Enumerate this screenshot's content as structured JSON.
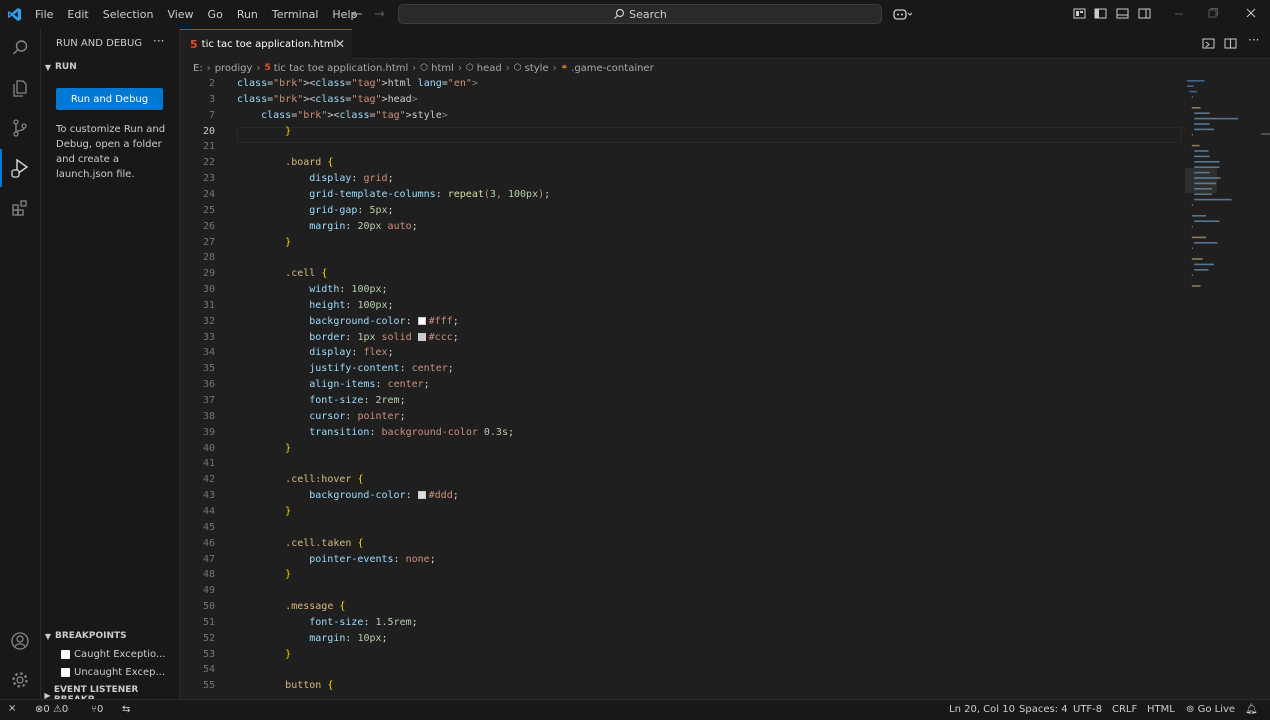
{
  "menu": [
    "File",
    "Edit",
    "Selection",
    "View",
    "Go",
    "Run",
    "Terminal",
    "Help"
  ],
  "search": {
    "label": "Search"
  },
  "sidebar": {
    "title": "RUN AND DEBUG",
    "run_section": "RUN",
    "run_button": "Run and Debug",
    "help_text": "To customize Run and Debug, open a folder and create a launch.json file.",
    "breakpoints_section": "BREAKPOINTS",
    "breakpoints": [
      "Caught Exceptio...",
      "Uncaught Excep..."
    ],
    "event_listener_section": "EVENT LISTENER BREAKP..."
  },
  "tab": {
    "label": "tic tac toe application.html"
  },
  "breadcrumb": {
    "drive": "E:",
    "items": [
      "prodigy",
      "tic tac toe application.html",
      "html",
      "head",
      "style",
      ".game-container"
    ]
  },
  "code": {
    "lines": [
      {
        "n": "2",
        "t": "<html lang=\"en\">"
      },
      {
        "n": "3",
        "t": "<head>"
      },
      {
        "n": "7",
        "t": "    <style>"
      },
      {
        "n": "20",
        "t": "        }"
      },
      {
        "n": "21",
        "t": ""
      },
      {
        "n": "22",
        "t": "        .board {"
      },
      {
        "n": "23",
        "t": "            display: grid;"
      },
      {
        "n": "24",
        "t": "            grid-template-columns: repeat(3, 100px);"
      },
      {
        "n": "25",
        "t": "            grid-gap: 5px;"
      },
      {
        "n": "26",
        "t": "            margin: 20px auto;"
      },
      {
        "n": "27",
        "t": "        }"
      },
      {
        "n": "28",
        "t": ""
      },
      {
        "n": "29",
        "t": "        .cell {"
      },
      {
        "n": "30",
        "t": "            width: 100px;"
      },
      {
        "n": "31",
        "t": "            height: 100px;"
      },
      {
        "n": "32",
        "t": "            background-color: #fff;"
      },
      {
        "n": "33",
        "t": "            border: 1px solid #ccc;"
      },
      {
        "n": "34",
        "t": "            display: flex;"
      },
      {
        "n": "35",
        "t": "            justify-content: center;"
      },
      {
        "n": "36",
        "t": "            align-items: center;"
      },
      {
        "n": "37",
        "t": "            font-size: 2rem;"
      },
      {
        "n": "38",
        "t": "            cursor: pointer;"
      },
      {
        "n": "39",
        "t": "            transition: background-color 0.3s;"
      },
      {
        "n": "40",
        "t": "        }"
      },
      {
        "n": "41",
        "t": ""
      },
      {
        "n": "42",
        "t": "        .cell:hover {"
      },
      {
        "n": "43",
        "t": "            background-color: #ddd;"
      },
      {
        "n": "44",
        "t": "        }"
      },
      {
        "n": "45",
        "t": ""
      },
      {
        "n": "46",
        "t": "        .cell.taken {"
      },
      {
        "n": "47",
        "t": "            pointer-events: none;"
      },
      {
        "n": "48",
        "t": "        }"
      },
      {
        "n": "49",
        "t": ""
      },
      {
        "n": "50",
        "t": "        .message {"
      },
      {
        "n": "51",
        "t": "            font-size: 1.5rem;"
      },
      {
        "n": "52",
        "t": "            margin: 10px;"
      },
      {
        "n": "53",
        "t": "        }"
      },
      {
        "n": "54",
        "t": ""
      },
      {
        "n": "55",
        "t": "        button {"
      }
    ]
  },
  "status": {
    "errors": "0",
    "warnings": "0",
    "ports": "0",
    "position": "Ln 20, Col 10",
    "spaces": "Spaces: 4",
    "encoding": "UTF-8",
    "eol": "CRLF",
    "language": "HTML",
    "golive": "Go Live"
  },
  "colors": {
    "accent": "#0078d4",
    "background": "#1f1f1f",
    "chrome": "#181818"
  }
}
